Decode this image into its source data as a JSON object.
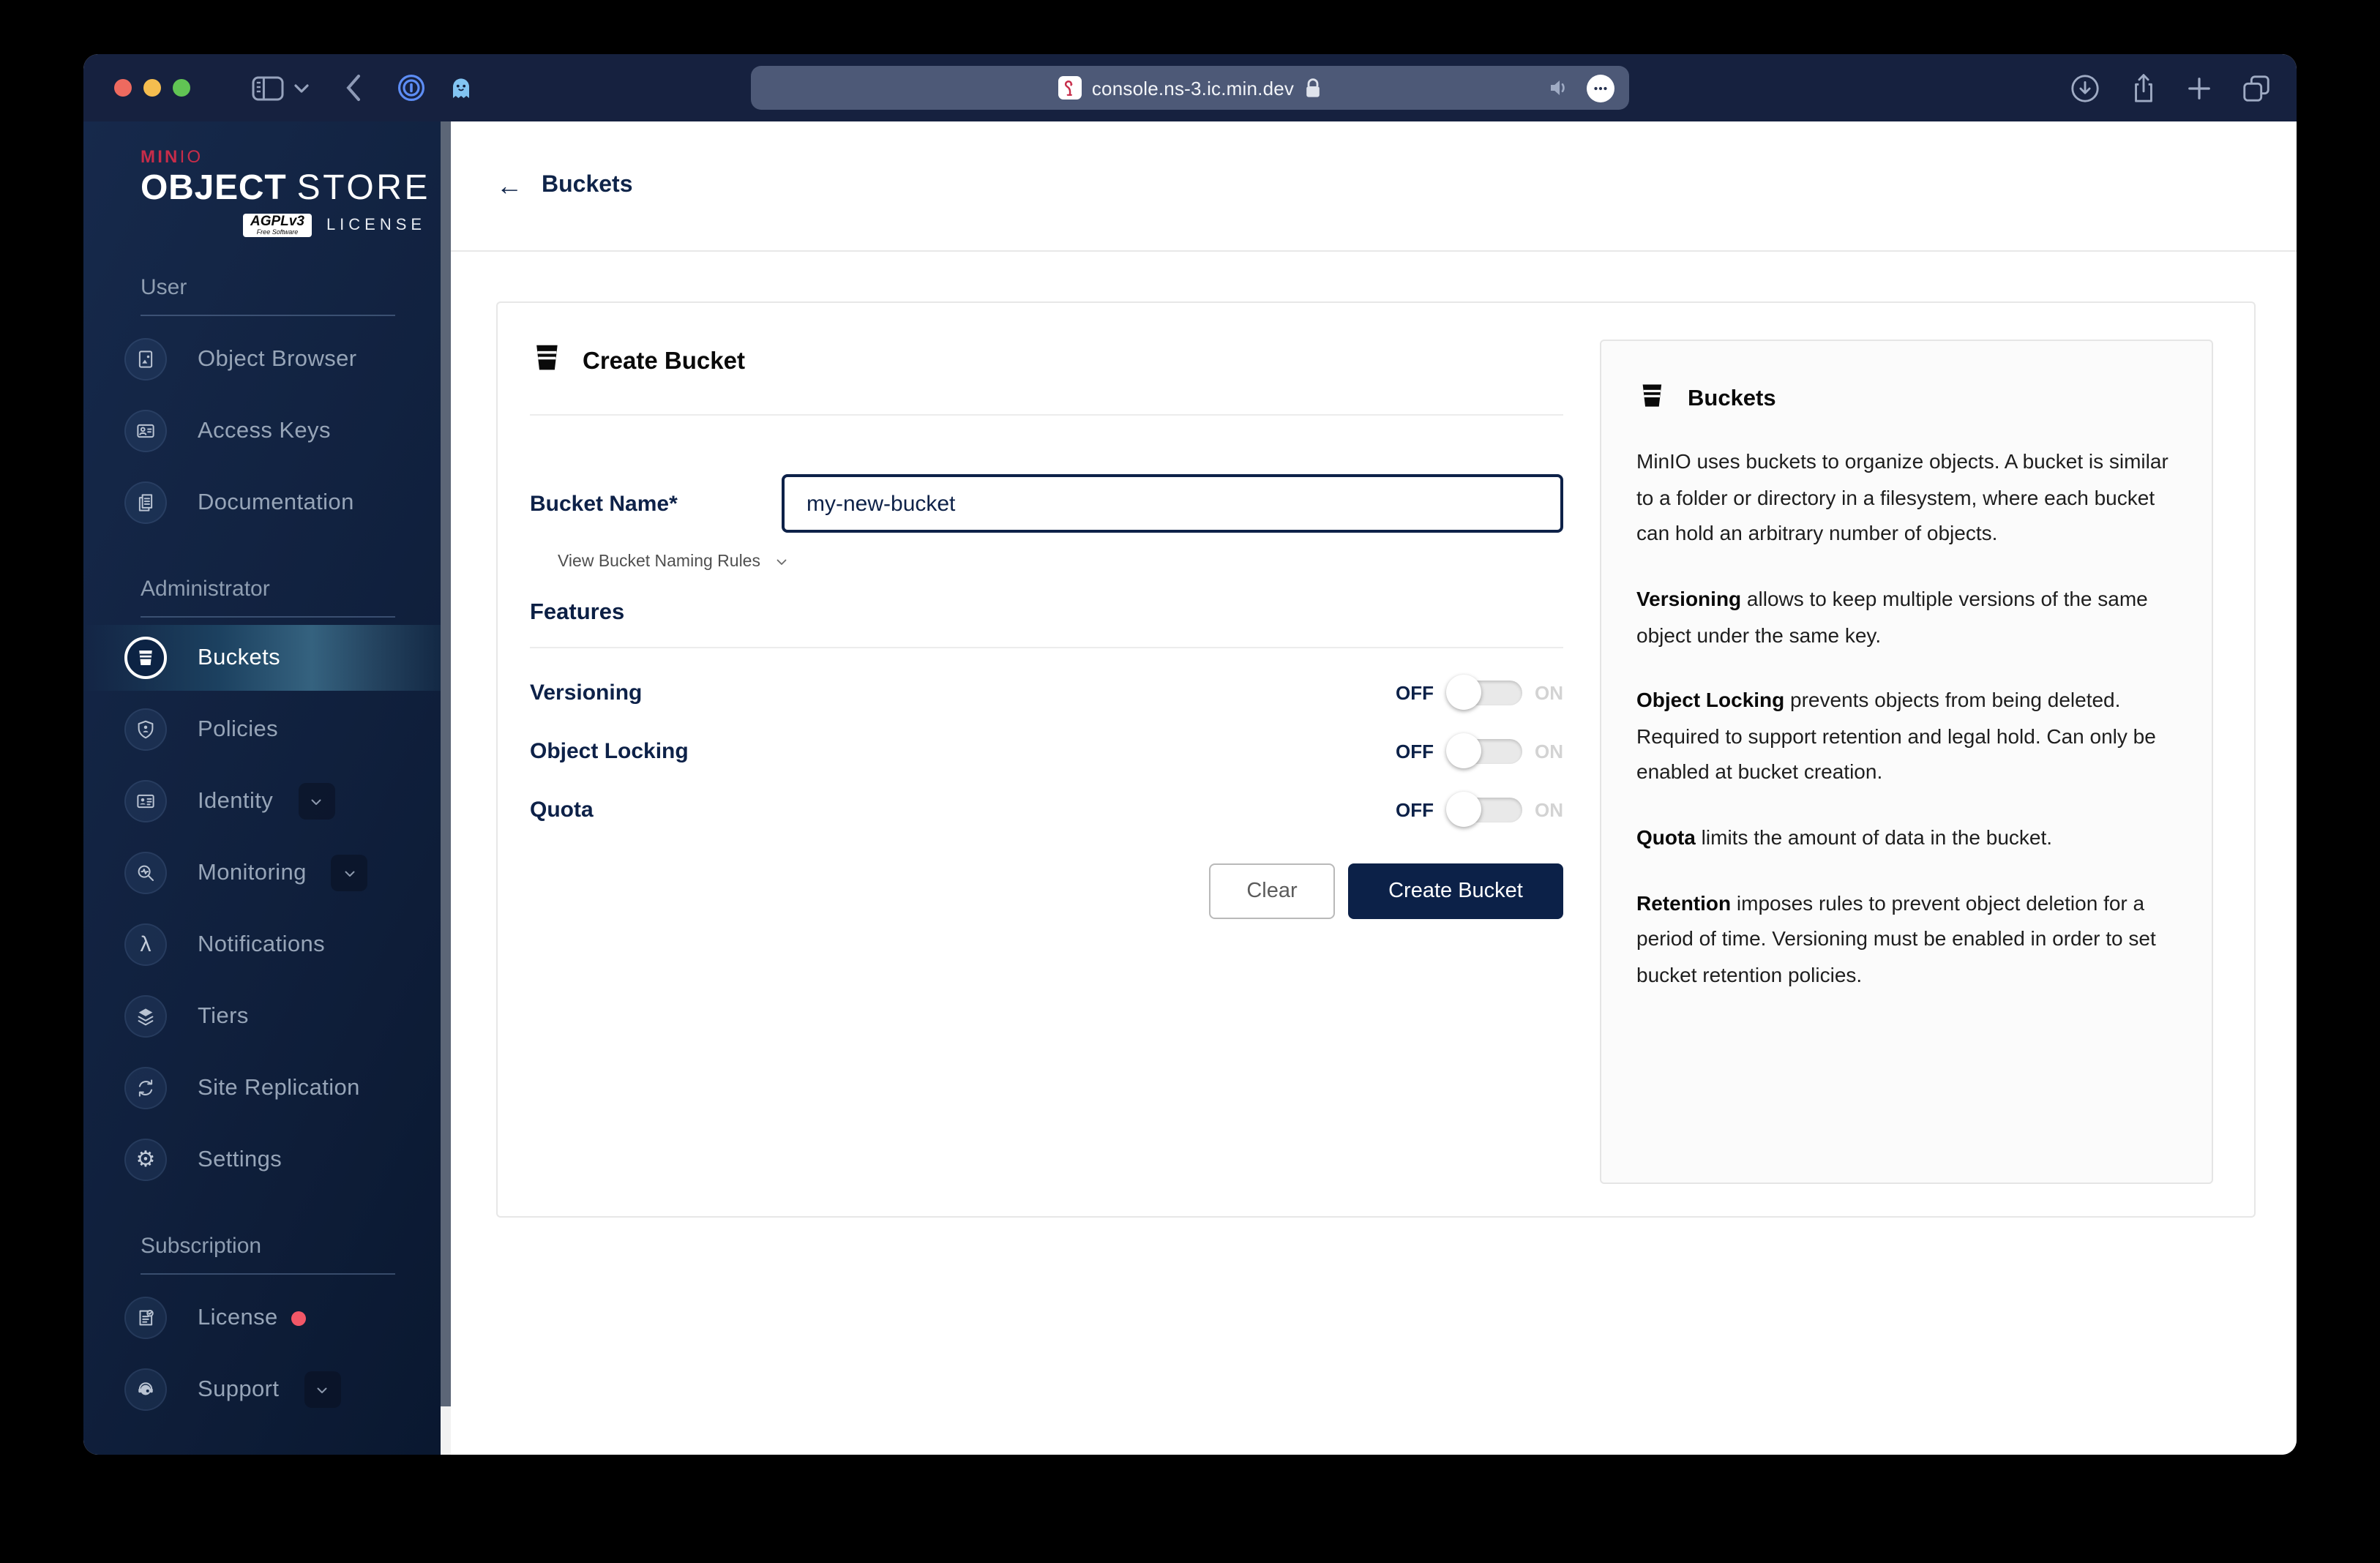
{
  "browser": {
    "url": "console.ns-3.ic.min.dev",
    "traffic_lights": [
      "#ee6a5f",
      "#f5bd4f",
      "#61c454"
    ],
    "chrome_bg": "#16213f",
    "urlbar_bg": "#4d5977"
  },
  "sidebar": {
    "logo": {
      "brand_bold": "MIN",
      "brand_light": "IO",
      "title_bold": "OBJECT",
      "title_light": "STORE",
      "license_badge": "AGPLv3",
      "license_badge_sub": "Free Software",
      "license_word": "LICENSE"
    },
    "sections": [
      {
        "label": "User",
        "items": [
          {
            "label": "Object Browser",
            "icon": "object-browser"
          },
          {
            "label": "Access Keys",
            "icon": "access-keys"
          },
          {
            "label": "Documentation",
            "icon": "documentation"
          }
        ]
      },
      {
        "label": "Administrator",
        "items": [
          {
            "label": "Buckets",
            "icon": "buckets",
            "active": true
          },
          {
            "label": "Policies",
            "icon": "policies"
          },
          {
            "label": "Identity",
            "icon": "identity",
            "chevron": true
          },
          {
            "label": "Monitoring",
            "icon": "monitoring",
            "chevron": true
          },
          {
            "label": "Notifications",
            "icon": "notifications"
          },
          {
            "label": "Tiers",
            "icon": "tiers"
          },
          {
            "label": "Site Replication",
            "icon": "site-replication"
          },
          {
            "label": "Settings",
            "icon": "settings"
          }
        ]
      },
      {
        "label": "Subscription",
        "items": [
          {
            "label": "License",
            "icon": "license",
            "dot": true
          },
          {
            "label": "Support",
            "icon": "support",
            "chevron": true
          }
        ]
      }
    ]
  },
  "header": {
    "back_glyph": "←",
    "title": "Buckets"
  },
  "form": {
    "title": "Create Bucket",
    "bucket_name_label": "Bucket Name*",
    "bucket_name_value": "my-new-bucket",
    "naming_rules_label": "View Bucket Naming Rules",
    "features_title": "Features",
    "off_label": "OFF",
    "on_label": "ON",
    "toggles": [
      {
        "label": "Versioning",
        "state": "off"
      },
      {
        "label": "Object Locking",
        "state": "off"
      },
      {
        "label": "Quota",
        "state": "off"
      }
    ],
    "clear_button": "Clear",
    "create_button": "Create Bucket"
  },
  "info_panel": {
    "title": "Buckets",
    "paragraphs": [
      {
        "bold": "",
        "text": "MinIO uses buckets to organize objects. A bucket is similar to a folder or directory in a filesystem, where each bucket can hold an arbitrary number of objects."
      },
      {
        "bold": "Versioning",
        "text": " allows to keep multiple versions of the same object under the same key."
      },
      {
        "bold": "Object Locking",
        "text": " prevents objects from being deleted. Required to support retention and legal hold. Can only be enabled at bucket creation."
      },
      {
        "bold": "Quota",
        "text": " limits the amount of data in the bucket."
      },
      {
        "bold": "Retention",
        "text": " imposes rules to prevent object deletion for a period of time. Versioning must be enabled in order to set bucket retention policies."
      }
    ]
  },
  "colors": {
    "navy_accent": "#0c2148",
    "minio_red": "#c72c49",
    "sidebar_text": "#97a5b8",
    "active_glow": "#35627f",
    "license_dot": "#f25767",
    "toggle_track": "#e9e9e9",
    "panel_bg": "#fbfbfb"
  }
}
